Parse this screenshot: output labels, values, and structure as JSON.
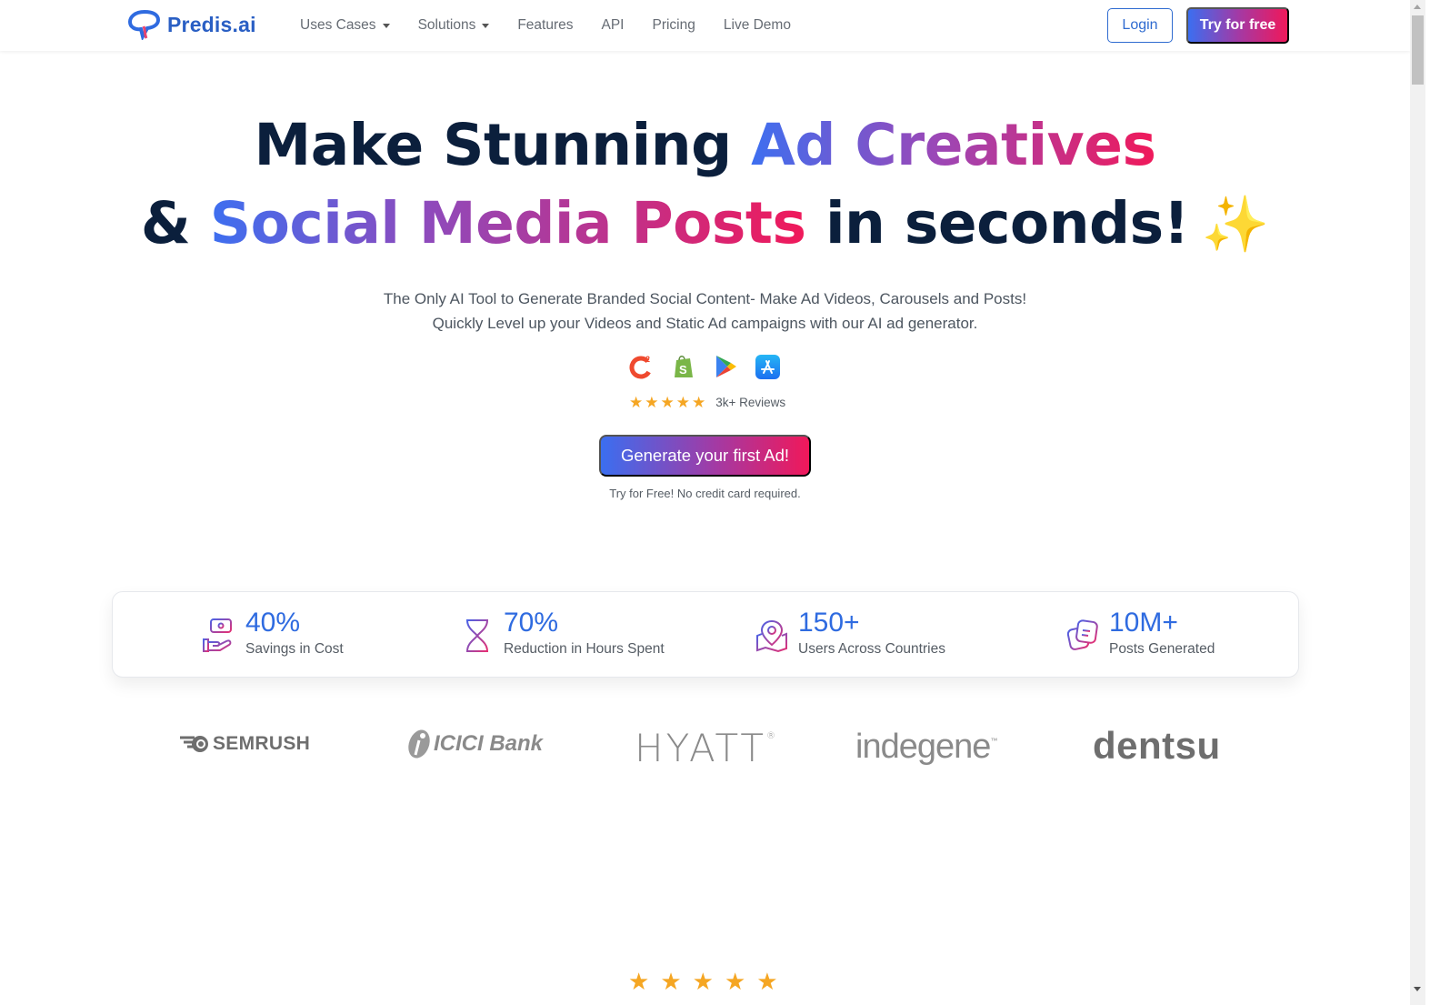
{
  "navbar": {
    "brand": "Predis.ai",
    "links": [
      {
        "label": "Uses Cases",
        "dropdown": true
      },
      {
        "label": "Solutions",
        "dropdown": true
      },
      {
        "label": "Features",
        "dropdown": false
      },
      {
        "label": "API",
        "dropdown": false
      },
      {
        "label": "Pricing",
        "dropdown": false
      },
      {
        "label": "Live Demo",
        "dropdown": false
      }
    ],
    "login_label": "Login",
    "try_label": "Try for free"
  },
  "hero": {
    "line1_plain": "Make Stunning ",
    "line1_gradient": "Ad Creatives",
    "line2_amp": "& ",
    "line2_gradient": "Social Media Posts",
    "line2_plain": " in seconds!",
    "sparkle": "✨",
    "subtitle_line1": "The Only AI Tool to Generate Branded Social Content- Make Ad Videos, Carousels and Posts!",
    "subtitle_line2": "Quickly Level up your Videos and Static Ad campaigns with our AI ad generator.",
    "badges": [
      "g2-icon",
      "shopify-icon",
      "google-play-icon",
      "app-store-icon"
    ],
    "rating_stars": 5,
    "reviews_label": "3k+ Reviews",
    "cta_label": "Generate your first Ad!",
    "cta_note": "Try for Free! No credit card required."
  },
  "stats": [
    {
      "icon": "money-hand-icon",
      "value": "40%",
      "label": "Savings in Cost"
    },
    {
      "icon": "hourglass-icon",
      "value": "70%",
      "label": "Reduction in Hours Spent"
    },
    {
      "icon": "map-pin-icon",
      "value": "150+",
      "label": "Users Across Countries"
    },
    {
      "icon": "posts-icon",
      "value": "10M+",
      "label": "Posts Generated"
    }
  ],
  "logos": {
    "semrush": "SEMRUSH",
    "icici": "ICICI Bank",
    "hyatt": "HYATT",
    "indegene": "indegene",
    "dentsu": "dentsu"
  },
  "bottom_rating_stars": 5,
  "colors": {
    "brand_blue": "#2f6be0",
    "gradient_start": "#3b6ef0",
    "gradient_mid": "#a23aa6",
    "gradient_end": "#f0185a",
    "heading_dark": "#0b1f3c",
    "star": "#f5a623"
  }
}
